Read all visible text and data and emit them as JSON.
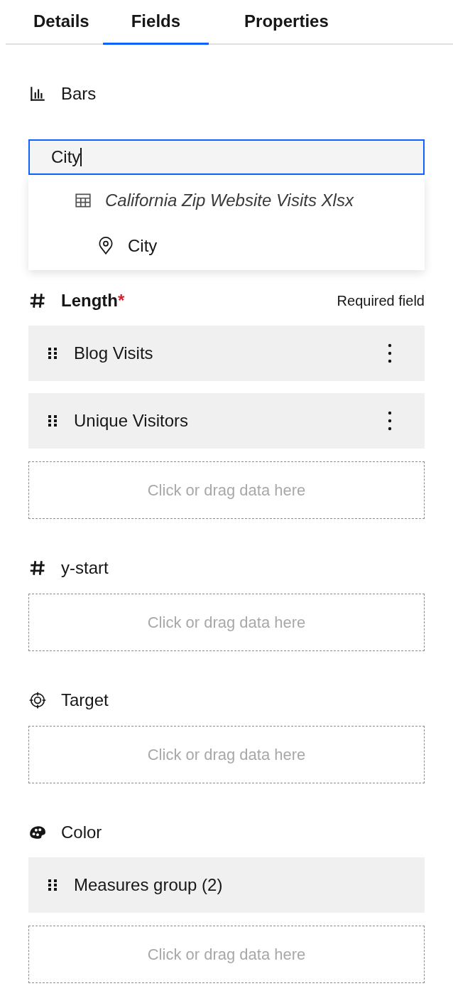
{
  "tabs": [
    {
      "label": "Details",
      "selected": false
    },
    {
      "label": "Fields",
      "selected": true
    },
    {
      "label": "Properties",
      "selected": false
    }
  ],
  "sections": [
    {
      "kind": "bars",
      "label": "Bars",
      "search": {
        "value": "City",
        "focused": true
      },
      "suggestions": [
        {
          "kind": "dataset",
          "label": "California Zip Website Visits Xlsx"
        },
        {
          "kind": "location",
          "label": "City"
        }
      ]
    },
    {
      "kind": "measure",
      "label": "Length",
      "required": true,
      "required_mark": "*",
      "required_note": "Required field",
      "items": [
        {
          "label": "Blog Visits",
          "menu": true
        },
        {
          "label": "Unique Visitors",
          "menu": true
        }
      ],
      "dropzone": "Click or drag data here"
    },
    {
      "kind": "measure",
      "label": "y-start",
      "required": false,
      "dropzone": "Click or drag data here"
    },
    {
      "kind": "target",
      "label": "Target",
      "required": false,
      "dropzone": "Click or drag data here"
    },
    {
      "kind": "color",
      "label": "Color",
      "required": false,
      "items": [
        {
          "label": "Measures group (2)",
          "menu": false
        }
      ],
      "dropzone": "Click or drag data here"
    }
  ]
}
